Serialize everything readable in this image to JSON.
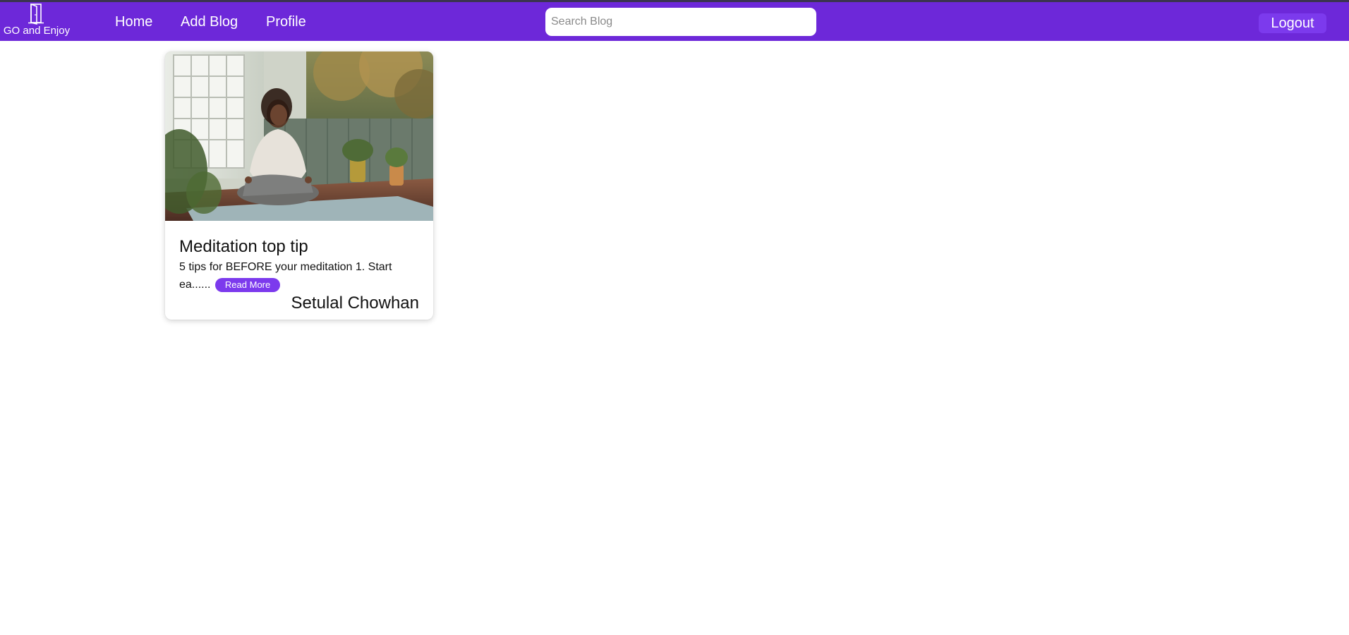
{
  "brand": {
    "name": "GO and Enjoy",
    "icon": "door-icon"
  },
  "nav": {
    "items": [
      {
        "label": "Home"
      },
      {
        "label": "Add Blog"
      },
      {
        "label": "Profile"
      }
    ]
  },
  "search": {
    "placeholder": "Search Blog",
    "value": ""
  },
  "logout": {
    "label": "Logout"
  },
  "colors": {
    "accent": "#6d28d9",
    "button": "#7c3aed"
  },
  "posts": [
    {
      "title": "Meditation top tip",
      "excerpt": "5 tips for BEFORE your meditation 1. Start ea......",
      "read_more_label": "Read More",
      "author": "Setulal Chowhan",
      "image": "woman-meditating-on-deck-photo"
    }
  ]
}
